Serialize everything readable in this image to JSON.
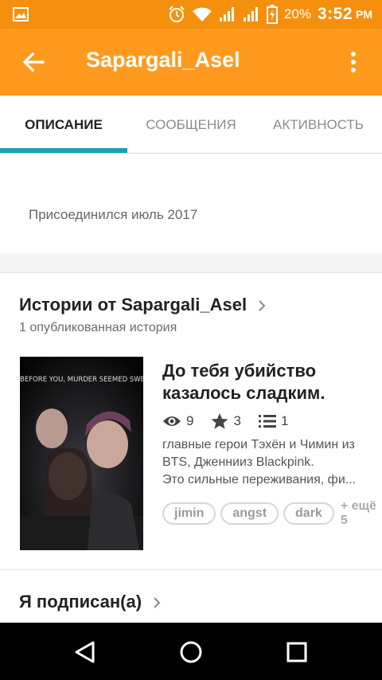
{
  "status_bar": {
    "battery_percent": "20%",
    "time": "3:52",
    "ampm": "PM",
    "icons": [
      "image-icon",
      "alarm-icon",
      "wifi-icon",
      "signal-icon",
      "signal-icon",
      "battery-charging-icon"
    ]
  },
  "toolbar": {
    "title": "Sapargali_Asel",
    "back_icon": "arrow-back-icon",
    "menu_icon": "more-vert-icon"
  },
  "tabs": [
    {
      "label": "ОПИСАНИЕ",
      "active": true
    },
    {
      "label": "СООБЩЕНИЯ",
      "active": false
    },
    {
      "label": "АКТИВНОСТЬ",
      "active": false
    }
  ],
  "profile": {
    "joined": "Присоединился июль 2017"
  },
  "stories_section": {
    "title": "Истории от Sapargali_Asel",
    "subtitle": "1 опубликованная история",
    "story": {
      "cover_text": "BEFORE YOU, MURDER SEEMED SWEE",
      "title_line1": "До тебя убийство",
      "title_line2": "казалось сладким.",
      "views": "9",
      "votes": "3",
      "parts": "1",
      "desc_line1": "главные герои Тэхён и Чимин из",
      "desc_line2": "BTS, Дженнииз Blackpink.",
      "desc_line3": "Это сильные переживания, фи...",
      "tags": [
        "jimin",
        "angst",
        "dark"
      ],
      "more_tags": "+ ещё 5"
    }
  },
  "following_section": {
    "title": "Я подписан(а)"
  },
  "colors": {
    "status_bar": "#f5900e",
    "toolbar": "#ff9a1f",
    "tab_indicator": "#1aa0b4"
  }
}
